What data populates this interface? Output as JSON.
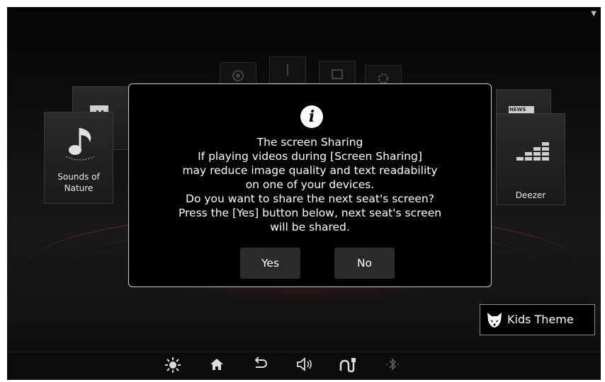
{
  "status": {
    "signal_icon": "signal-triangle-icon"
  },
  "home": {
    "tiles": [
      {
        "label_1": "Sounds of",
        "label_2": "Nature",
        "icon": "music-note-icon"
      },
      {
        "label": "Deezer",
        "icon": "equalizer-icon"
      }
    ],
    "back_tiles": [
      {
        "icon": "twitch-icon"
      },
      {
        "icon": "news-icon",
        "caption": "NEWS"
      }
    ]
  },
  "dialog": {
    "icon": "info-icon",
    "icon_glyph": "i",
    "lines": [
      "The screen Sharing",
      "If playing videos during [Screen Sharing]",
      "may reduce image quality and text readability",
      "on one of your devices.",
      "Do you want to share the next seat's screen?",
      "Press the [Yes] button below, next seat's screen",
      "will be shared."
    ],
    "yes_label": "Yes",
    "no_label": "No"
  },
  "kids_theme": {
    "label": "Kids Theme",
    "icon": "fox-icon"
  },
  "bottom_bar": {
    "items": [
      {
        "icon": "moon-icon"
      },
      {
        "icon": "brightness-icon"
      },
      {
        "icon": "home-icon"
      },
      {
        "icon": "back-icon"
      },
      {
        "icon": "volume-icon"
      },
      {
        "icon": "headphone-jack-icon"
      },
      {
        "icon": "bluetooth-icon"
      }
    ]
  },
  "colors": {
    "dialog_border": "#cfcfcf",
    "button_bg": "#2b2b2b",
    "accent_red": "#8c1e28"
  }
}
